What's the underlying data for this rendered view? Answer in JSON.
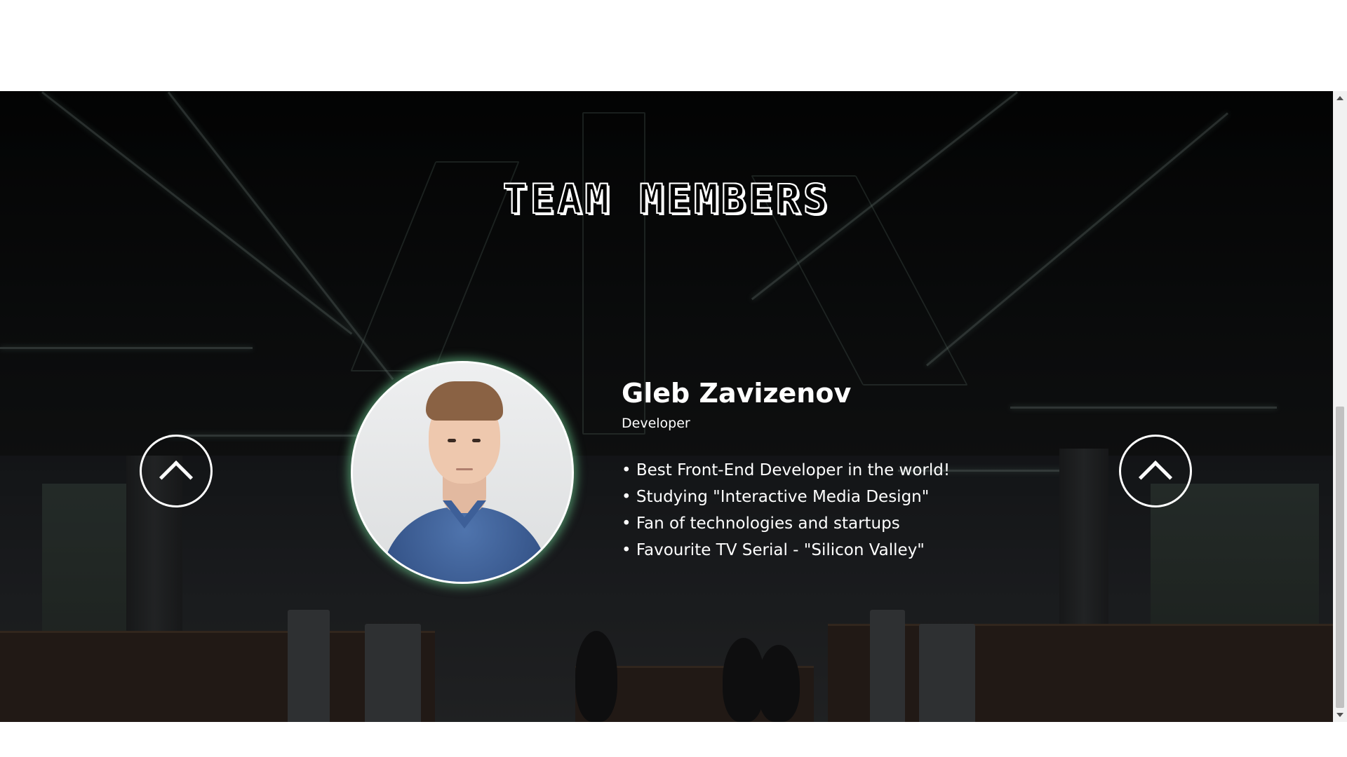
{
  "section": {
    "title": "TEAM MEMBERS"
  },
  "navigation": {
    "prev_icon": "chevron-up-icon",
    "next_icon": "chevron-up-icon"
  },
  "member": {
    "name": "Gleb Zavizenov",
    "role": "Developer",
    "facts": [
      "• Best Front-End Developer in the world!",
      "• Studying \"Interactive Media Design\"",
      "• Fan of technologies and startups",
      "• Favourite TV Serial - \"Silicon Valley\""
    ],
    "photo": "team-member-photo"
  },
  "colors": {
    "text": "#ffffff",
    "avatar_glow": "#78e6a0",
    "background": "#0c0d0e"
  }
}
